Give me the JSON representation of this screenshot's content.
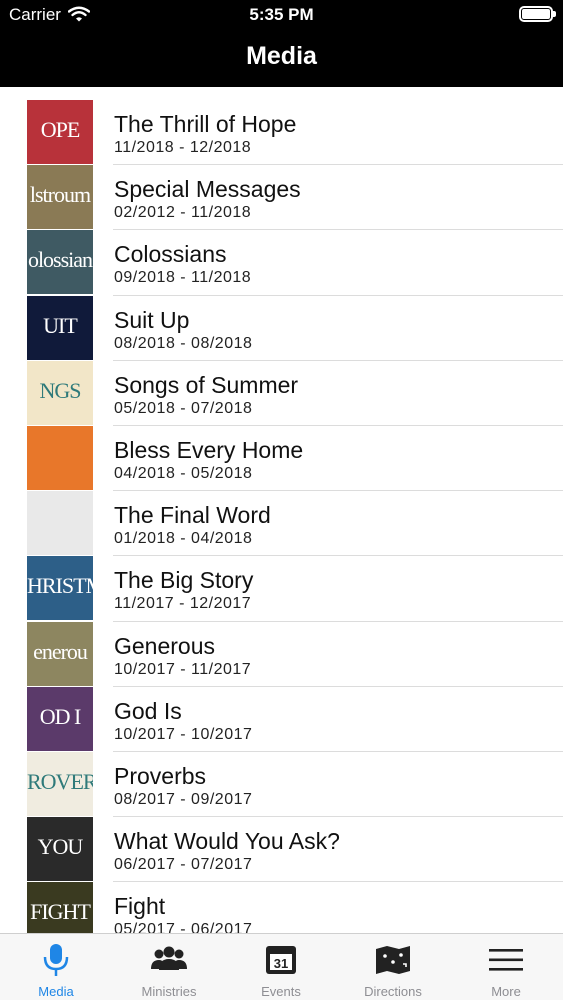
{
  "status": {
    "carrier": "Carrier",
    "time": "5:35 PM"
  },
  "nav": {
    "title": "Media"
  },
  "items": [
    {
      "title": "The Thrill of Hope",
      "dates": "11/2018 - 12/2018",
      "thumb_text": "OPE",
      "thumb_color": "#b8323a"
    },
    {
      "title": "Special Messages",
      "dates": "02/2012 - 11/2018",
      "thumb_text": "lstroum",
      "thumb_color": "#8a7a55"
    },
    {
      "title": "Colossians",
      "dates": "09/2018 - 11/2018",
      "thumb_text": "olossian",
      "thumb_color": "#3f5a63"
    },
    {
      "title": "Suit Up",
      "dates": "08/2018 - 08/2018",
      "thumb_text": "UIT",
      "thumb_color": "#101a3a"
    },
    {
      "title": "Songs of Summer",
      "dates": "05/2018 - 07/2018",
      "thumb_text": "NGS",
      "thumb_color": "#f2e6c8"
    },
    {
      "title": "Bless Every Home",
      "dates": "04/2018 - 05/2018",
      "thumb_text": "",
      "thumb_color": "#e8772a"
    },
    {
      "title": "The Final Word",
      "dates": "01/2018 - 04/2018",
      "thumb_text": "",
      "thumb_color": "#e9e9e9"
    },
    {
      "title": "The Big Story",
      "dates": "11/2017 - 12/2017",
      "thumb_text": "HRISTM",
      "thumb_color": "#2d5f88"
    },
    {
      "title": "Generous",
      "dates": "10/2017 - 11/2017",
      "thumb_text": "enerou",
      "thumb_color": "#8d8660"
    },
    {
      "title": "God Is",
      "dates": "10/2017 - 10/2017",
      "thumb_text": "OD I",
      "thumb_color": "#5b3a6a"
    },
    {
      "title": "Proverbs",
      "dates": "08/2017 - 09/2017",
      "thumb_text": "ROVERE",
      "thumb_color": "#f0ece0"
    },
    {
      "title": "What Would You Ask?",
      "dates": "06/2017 - 07/2017",
      "thumb_text": "YOU",
      "thumb_color": "#2a2a2a"
    },
    {
      "title": "Fight",
      "dates": "05/2017 - 06/2017",
      "thumb_text": "FIGHT",
      "thumb_color": "#3a3a20"
    }
  ],
  "tabs": [
    {
      "label": "Media",
      "icon": "microphone-icon",
      "active": true
    },
    {
      "label": "Ministries",
      "icon": "people-icon",
      "active": false
    },
    {
      "label": "Events",
      "icon": "calendar-icon",
      "active": false
    },
    {
      "label": "Directions",
      "icon": "map-icon",
      "active": false
    },
    {
      "label": "More",
      "icon": "hamburger-icon",
      "active": false
    }
  ],
  "colors": {
    "accent": "#1f86e6",
    "bar": "#000000",
    "tab_inactive": "#8e8e93"
  }
}
